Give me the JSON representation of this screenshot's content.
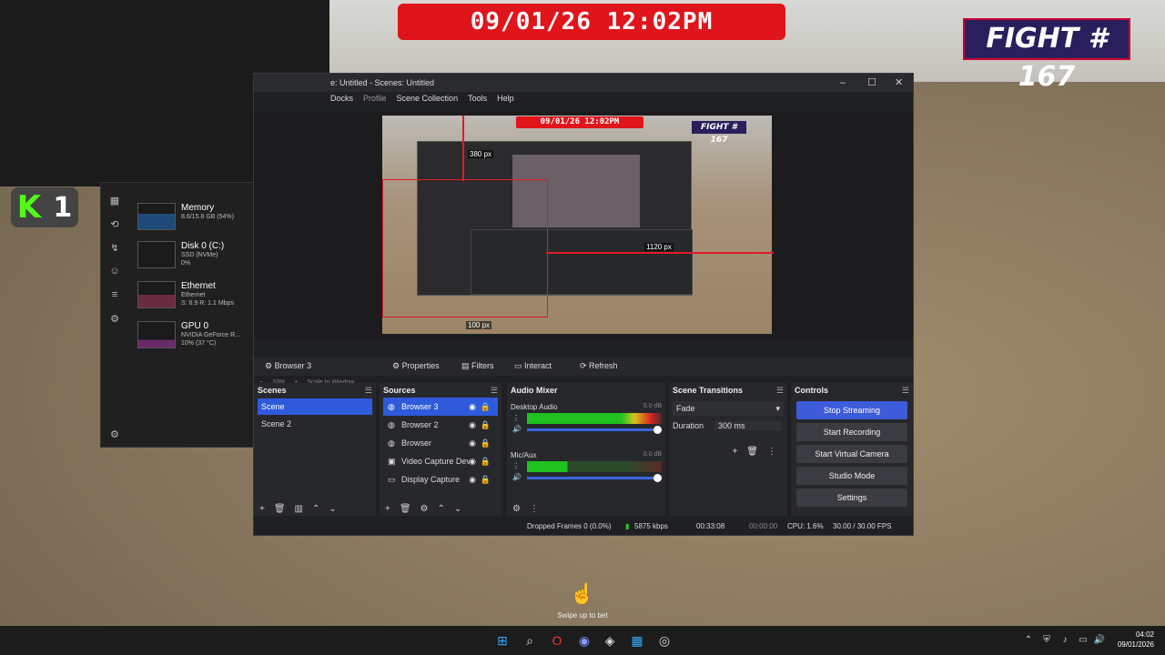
{
  "overlay": {
    "date_banner": "09/01/26 12:02PM",
    "fight": "FIGHT # 167",
    "k_count": "1",
    "k_letter": "K"
  },
  "task_manager": {
    "items": [
      {
        "name": "Memory",
        "sub1": "8.6/15.8 GB (54%)",
        "sub2": ""
      },
      {
        "name": "Disk 0 (C:)",
        "sub1": "SSD (NVMe)",
        "sub2": "0%"
      },
      {
        "name": "Ethernet",
        "sub1": "Ethernet",
        "sub2": "S: 6.9 R: 1.1 Mbps"
      },
      {
        "name": "GPU 0",
        "sub1": "NVIDIA GeForce R...",
        "sub2": "10% (37 °C)"
      }
    ]
  },
  "obs": {
    "title": "e: Untitled - Scenes: Untitled",
    "menu": [
      "Docks",
      "Profile",
      "Scene Collection",
      "Tools",
      "Help"
    ],
    "preview": {
      "date": "09/01/26 12:02PM",
      "fight": "FIGHT # 167",
      "m_top": "380 px",
      "m_right": "1120 px",
      "m_bottom": "100 px",
      "zoom": "33%",
      "scale": "Scale to Window"
    },
    "toolbar": {
      "source": "Browser 3",
      "properties": "Properties",
      "filters": "Filters",
      "interact": "Interact",
      "refresh": "Refresh"
    },
    "scenes": {
      "title": "Scenes",
      "items": [
        "Scene",
        "Scene 2"
      ]
    },
    "sources": {
      "title": "Sources",
      "items": [
        "Browser 3",
        "Browser 2",
        "Browser",
        "Video Capture Dev",
        "Display Capture"
      ]
    },
    "mixer": {
      "title": "Audio Mixer",
      "channels": [
        {
          "name": "Desktop Audio",
          "db": "0.0 dB"
        },
        {
          "name": "Mic/Aux",
          "db": "0.0 dB"
        }
      ]
    },
    "transitions": {
      "title": "Scene Transitions",
      "type": "Fade",
      "duration_label": "Duration",
      "duration": "300 ms"
    },
    "controls": {
      "title": "Controls",
      "buttons": [
        "Stop Streaming",
        "Start Recording",
        "Start Virtual Camera",
        "Studio Mode",
        "Settings"
      ]
    },
    "status": {
      "dropped": "Dropped Frames 0 (0.0%)",
      "bitrate": "5875 kbps",
      "stream_time": "00:33:08",
      "rec_time": "00:00:00",
      "cpu": "CPU: 1.6%",
      "fps": "30.00 / 30.00 FPS"
    }
  },
  "swipe_text": "Swipe up to bet",
  "clock": {
    "time": "04:02",
    "date": "09/01/2026"
  }
}
